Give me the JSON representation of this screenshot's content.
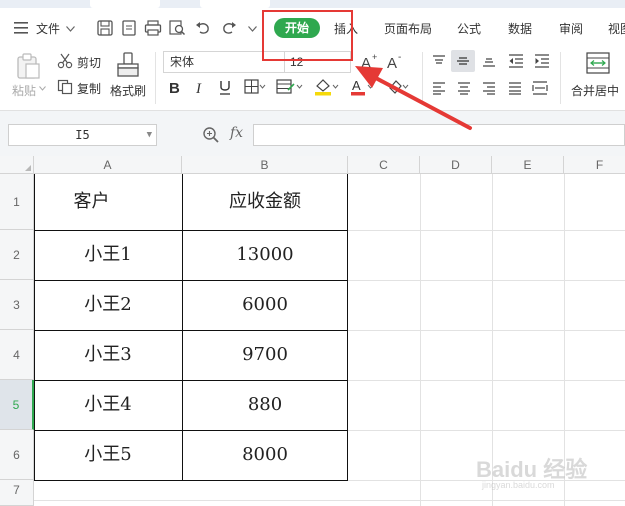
{
  "menubar": {
    "file_label": "文件",
    "tabs": [
      {
        "id": "kaishi",
        "label": "开始",
        "active": true
      },
      {
        "id": "charu",
        "label": "插入"
      },
      {
        "id": "yemian",
        "label": "页面布局"
      },
      {
        "id": "gongshi",
        "label": "公式"
      },
      {
        "id": "shuju",
        "label": "数据"
      },
      {
        "id": "shenyue",
        "label": "审阅"
      },
      {
        "id": "shitu",
        "label": "视图"
      }
    ]
  },
  "ribbon": {
    "paste_label": "粘贴",
    "cut_label": "剪切",
    "copy_label": "复制",
    "format_painter_label": "格式刷",
    "font_name": "宋体",
    "font_size": "12",
    "merge_center_label": "合并居中"
  },
  "formula_bar": {
    "name_box": "I5",
    "fx_label": "fx",
    "formula": ""
  },
  "grid": {
    "columns": [
      "A",
      "B",
      "C",
      "D",
      "E",
      "F"
    ],
    "rows": [
      "1",
      "2",
      "3",
      "4",
      "5",
      "6",
      "7"
    ],
    "active_row": "5",
    "cells": {
      "A1": "客户",
      "B1": "应收金额",
      "A2": "小王1",
      "B2": "13000",
      "A3": "小王2",
      "B3": "6000",
      "A4": "小王3",
      "B4": "9700",
      "A5": "小王4",
      "B5": "880",
      "A6": "小王5",
      "B6": "8000"
    }
  },
  "annotation": {
    "highlight_color": "#e53935",
    "accent_green": "#2fa84f"
  },
  "watermark": {
    "text": "Baidu 经验",
    "sub": "jingyan.baidu.com"
  }
}
